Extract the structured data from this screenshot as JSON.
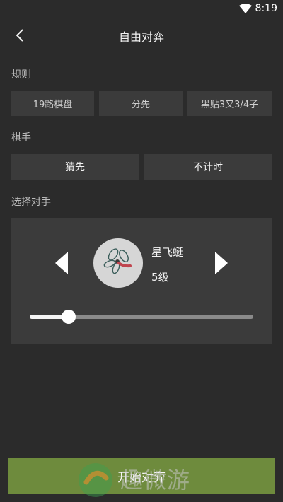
{
  "status": {
    "time": "8:19"
  },
  "header": {
    "title": "自由对弈"
  },
  "rules": {
    "label": "规则",
    "options": [
      {
        "label": "19路棋盘"
      },
      {
        "label": "分先"
      },
      {
        "label": "黑贴3又3/4子"
      }
    ]
  },
  "hand": {
    "label": "棋手",
    "options": [
      {
        "label": "猜先"
      },
      {
        "label": "不计时"
      }
    ]
  },
  "opponent": {
    "label": "选择对手",
    "name": "星飞蜓",
    "level": "5级",
    "avatar_icon": "dragonfly-icon",
    "slider_fraction": 0.175
  },
  "start_button": {
    "label": "开始对弈"
  },
  "watermark": {
    "text": "趣微游"
  },
  "colors": {
    "background": "#2b2b2b",
    "option": "#3b3b3b",
    "accent": "#6e8b3d"
  }
}
